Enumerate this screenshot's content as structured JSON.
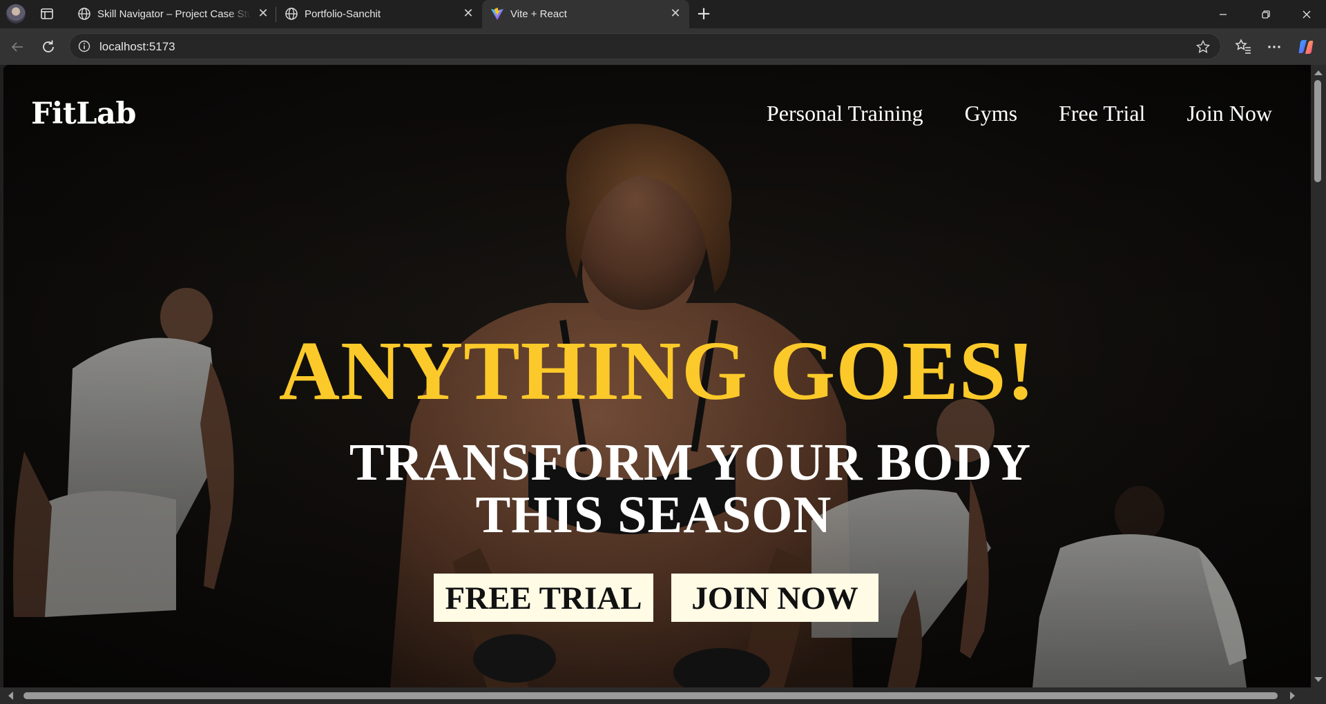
{
  "browser": {
    "tabs": [
      {
        "title": "Skill Navigator – Project Case Stud",
        "favicon": "globe-icon",
        "active": false
      },
      {
        "title": "Portfolio-Sanchit",
        "favicon": "globe-icon",
        "active": false
      },
      {
        "title": "Vite + React",
        "favicon": "vite-logo-icon",
        "active": true
      }
    ],
    "url": "localhost:5173",
    "colors": {
      "chrome": "#202020",
      "toolbar": "#333333"
    }
  },
  "page": {
    "brand": "FitLab",
    "nav": [
      "Personal Training",
      "Gyms",
      "Free Trial",
      "Join Now"
    ],
    "headline": "ANYTHING GOES!",
    "subheadline_line1": "TRANSFORM YOUR BODY",
    "subheadline_line2": "THIS SEASON",
    "cta_free": "FREE TRIAL",
    "cta_join": "JOIN NOW",
    "colors": {
      "headline": "#fcc92a",
      "button_bg": "#fffbe5",
      "text": "#ffffff"
    }
  }
}
